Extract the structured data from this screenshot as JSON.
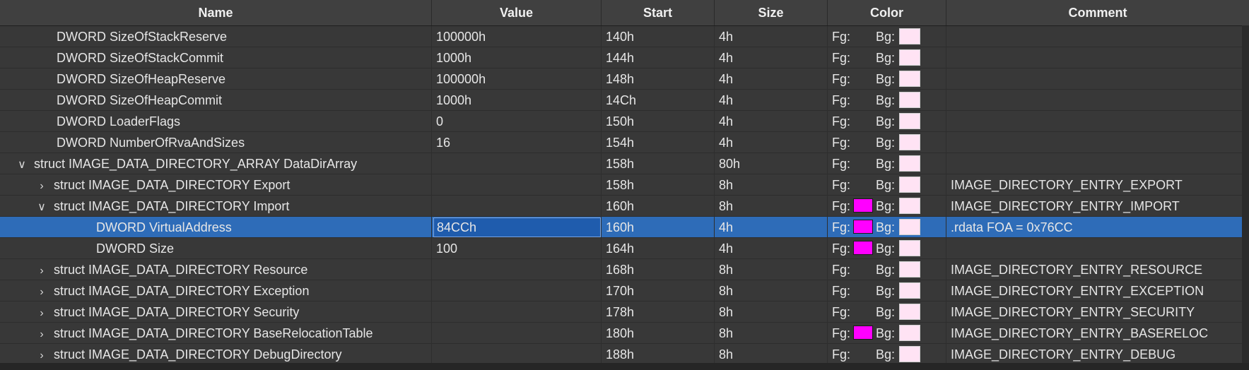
{
  "columns": [
    "Name",
    "Value",
    "Start",
    "Size",
    "Color",
    "Comment"
  ],
  "colors": {
    "fg_magenta": "#ff00ff",
    "bg_pink": "#ffe3f4",
    "selected": "#2e6cb8"
  },
  "labels": {
    "fg": "Fg:",
    "bg": "Bg:"
  },
  "rows": [
    {
      "indent": 1,
      "toggle": "",
      "name": "DWORD SizeOfStackReserve",
      "value": "100000h",
      "start": "140h",
      "size": "4h",
      "fg": "",
      "comment": ""
    },
    {
      "indent": 1,
      "toggle": "",
      "name": "DWORD SizeOfStackCommit",
      "value": "1000h",
      "start": "144h",
      "size": "4h",
      "fg": "",
      "comment": ""
    },
    {
      "indent": 1,
      "toggle": "",
      "name": "DWORD SizeOfHeapReserve",
      "value": "100000h",
      "start": "148h",
      "size": "4h",
      "fg": "",
      "comment": ""
    },
    {
      "indent": 1,
      "toggle": "",
      "name": "DWORD SizeOfHeapCommit",
      "value": "1000h",
      "start": "14Ch",
      "size": "4h",
      "fg": "",
      "comment": ""
    },
    {
      "indent": 1,
      "toggle": "",
      "name": "DWORD LoaderFlags",
      "value": "0",
      "start": "150h",
      "size": "4h",
      "fg": "",
      "comment": ""
    },
    {
      "indent": 1,
      "toggle": "",
      "name": "DWORD NumberOfRvaAndSizes",
      "value": "16",
      "start": "154h",
      "size": "4h",
      "fg": "",
      "comment": ""
    },
    {
      "indent": 0,
      "toggle": "expanded",
      "name": "struct IMAGE_DATA_DIRECTORY_ARRAY DataDirArray",
      "value": "",
      "start": "158h",
      "size": "80h",
      "fg": "",
      "comment": ""
    },
    {
      "indent": 1,
      "toggle": "collapsed",
      "name": "struct IMAGE_DATA_DIRECTORY Export",
      "value": "",
      "start": "158h",
      "size": "8h",
      "fg": "",
      "comment": "IMAGE_DIRECTORY_ENTRY_EXPORT"
    },
    {
      "indent": 1,
      "toggle": "expanded",
      "name": "struct IMAGE_DATA_DIRECTORY Import",
      "value": "",
      "start": "160h",
      "size": "8h",
      "fg": "magenta",
      "comment": "IMAGE_DIRECTORY_ENTRY_IMPORT"
    },
    {
      "indent": 3,
      "toggle": "",
      "name": "DWORD VirtualAddress",
      "value": "84CCh",
      "start": "160h",
      "size": "4h",
      "fg": "magenta",
      "comment": ".rdata FOA = 0x76CC",
      "selected": true
    },
    {
      "indent": 3,
      "toggle": "",
      "name": "DWORD Size",
      "value": "100",
      "start": "164h",
      "size": "4h",
      "fg": "magenta",
      "comment": ""
    },
    {
      "indent": 1,
      "toggle": "collapsed",
      "name": "struct IMAGE_DATA_DIRECTORY Resource",
      "value": "",
      "start": "168h",
      "size": "8h",
      "fg": "",
      "comment": "IMAGE_DIRECTORY_ENTRY_RESOURCE"
    },
    {
      "indent": 1,
      "toggle": "collapsed",
      "name": "struct IMAGE_DATA_DIRECTORY Exception",
      "value": "",
      "start": "170h",
      "size": "8h",
      "fg": "",
      "comment": "IMAGE_DIRECTORY_ENTRY_EXCEPTION"
    },
    {
      "indent": 1,
      "toggle": "collapsed",
      "name": "struct IMAGE_DATA_DIRECTORY Security",
      "value": "",
      "start": "178h",
      "size": "8h",
      "fg": "",
      "comment": "IMAGE_DIRECTORY_ENTRY_SECURITY"
    },
    {
      "indent": 1,
      "toggle": "collapsed",
      "name": "struct IMAGE_DATA_DIRECTORY BaseRelocationTable",
      "value": "",
      "start": "180h",
      "size": "8h",
      "fg": "magenta",
      "comment": "IMAGE_DIRECTORY_ENTRY_BASERELOC"
    },
    {
      "indent": 1,
      "toggle": "collapsed",
      "name": "struct IMAGE_DATA_DIRECTORY DebugDirectory",
      "value": "",
      "start": "188h",
      "size": "8h",
      "fg": "",
      "comment": "IMAGE_DIRECTORY_ENTRY_DEBUG"
    }
  ]
}
